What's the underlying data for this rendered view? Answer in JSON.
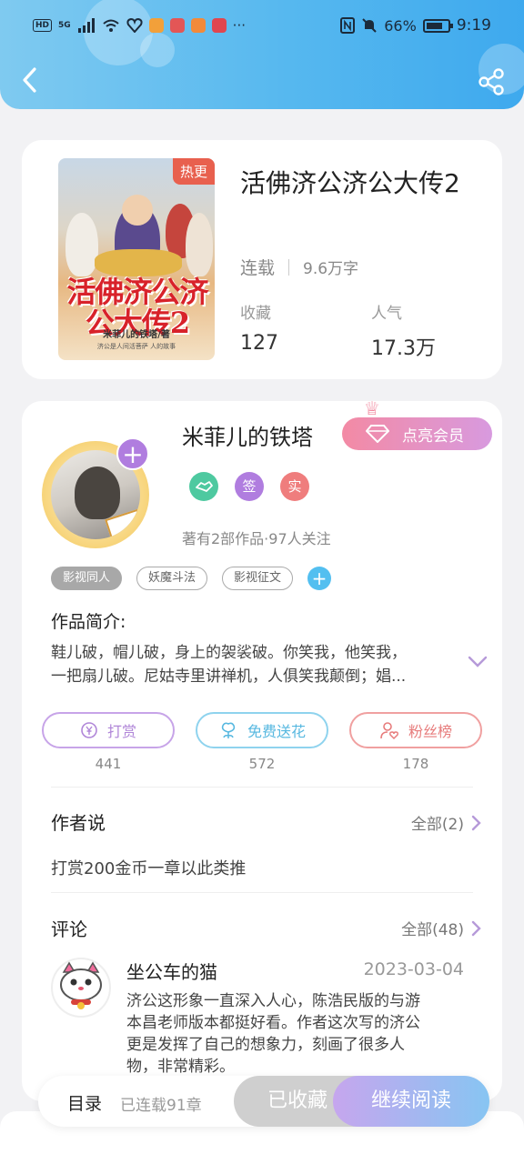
{
  "status_bar": {
    "left_chips": [
      "HD",
      "5G"
    ],
    "battery": "66%",
    "time": "9:19",
    "more": "···"
  },
  "book": {
    "title": "活佛济公济公大传2",
    "status": "连载",
    "words": "9.6万字",
    "hot_tag": "热更",
    "cover_title": "活佛济公济公大传2",
    "cover_author": "米菲儿的铁塔/著",
    "cover_sub": "济公是人间活菩萨 人的故事",
    "stats": [
      {
        "label": "收藏",
        "value": "127"
      },
      {
        "label": "人气",
        "value": "17.3万"
      }
    ]
  },
  "author": {
    "name": "米菲儿的铁塔",
    "vip_button": "点亮会员",
    "badges": [
      {
        "icon": "handshake-icon",
        "text": "",
        "color": "#4ec9a0"
      },
      {
        "icon": "sign-icon",
        "text": "签",
        "color": "#b07ddf"
      },
      {
        "icon": "verified-icon",
        "text": "实",
        "color": "#ef7d7d"
      }
    ],
    "stats": "著有2部作品·97人关注"
  },
  "tags": [
    "影视同人",
    "妖魔斗法",
    "影视征文"
  ],
  "intro": {
    "title": "作品简介:",
    "text_line1": "鞋儿破，帽儿破，身上的袈裟破。你笑我，他笑我，",
    "text_line2": "一把扇儿破。尼姑寺里讲禅机，人俱笑我颠倒；娼..."
  },
  "actions": [
    {
      "label": "打赏",
      "count": "441",
      "color": "#c7a4e8",
      "text_color": "#b086d8",
      "icon": "coin-icon"
    },
    {
      "label": "免费送花",
      "count": "572",
      "color": "#8fd3ee",
      "text_color": "#57b8e0",
      "icon": "flower-icon"
    },
    {
      "label": "粉丝榜",
      "count": "178",
      "color": "#f0a0a0",
      "text_color": "#e77c7c",
      "icon": "fan-icon"
    }
  ],
  "author_says": {
    "title": "作者说",
    "more": "全部(2)",
    "text": "打赏200金币一章以此类推"
  },
  "comments": {
    "title": "评论",
    "more": "全部(48)",
    "items": [
      {
        "user": "坐公车的猫",
        "date": "2023-03-04",
        "line1": "济公这形象一直深入人心，陈浩民版的与游",
        "line2": "本昌老师版本都挺好看。作者这次写的济公",
        "line3": "更是发挥了自己的想象力，刻画了很多人",
        "line4": "物，非常精彩。"
      }
    ]
  },
  "bottom_bar": {
    "toc": "目录",
    "chapters": "已连载91章",
    "favorite": "已收藏",
    "continue": "继续阅读"
  }
}
